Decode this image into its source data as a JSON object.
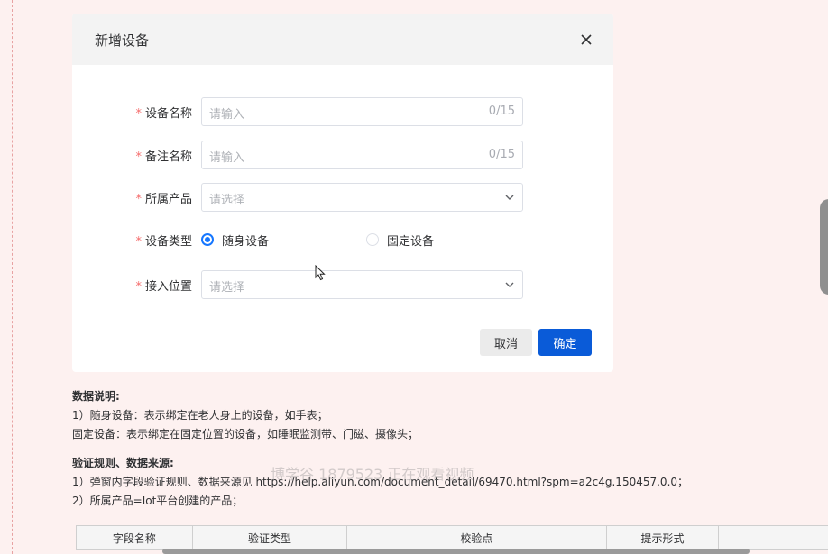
{
  "dialog": {
    "title": "新增设备",
    "close_icon": "close-icon",
    "fields": {
      "device_name": {
        "label": "设备名称",
        "placeholder": "请输入",
        "count": "0/15"
      },
      "remark_name": {
        "label": "备注名称",
        "placeholder": "请输入",
        "count": "0/15"
      },
      "product": {
        "label": "所属产品",
        "placeholder": "请选择"
      },
      "device_type": {
        "label": "设备类型",
        "options": [
          "随身设备",
          "固定设备"
        ],
        "selected": "随身设备"
      },
      "location": {
        "label": "接入位置",
        "placeholder": "请选择"
      }
    },
    "required_mark": "*",
    "cancel_label": "取消",
    "ok_label": "确定"
  },
  "notes": {
    "data_title": "数据说明:",
    "data_line1": "1）随身设备：表示绑定在老人身上的设备，如手表；",
    "data_line2": "固定设备：表示绑定在固定位置的设备，如睡眠监测带、门磁、摄像头；",
    "rules_title": "验证规则、数据来源:",
    "rules_line1": "1）弹窗内字段验证规则、数据来源见 https://help.aliyun.com/document_detail/69470.html?spm=a2c4g.150457.0.0；",
    "rules_line2": "2）所属产品=Iot平台创建的产品；"
  },
  "watermark": "博学谷 1879523 正在观看视频",
  "table": {
    "headers": [
      "字段名称",
      "验证类型",
      "校验点",
      "提示形式",
      ""
    ]
  },
  "colors": {
    "primary": "#0a5bd8",
    "required": "#f56c6c",
    "radio_active": "#1677ff"
  }
}
